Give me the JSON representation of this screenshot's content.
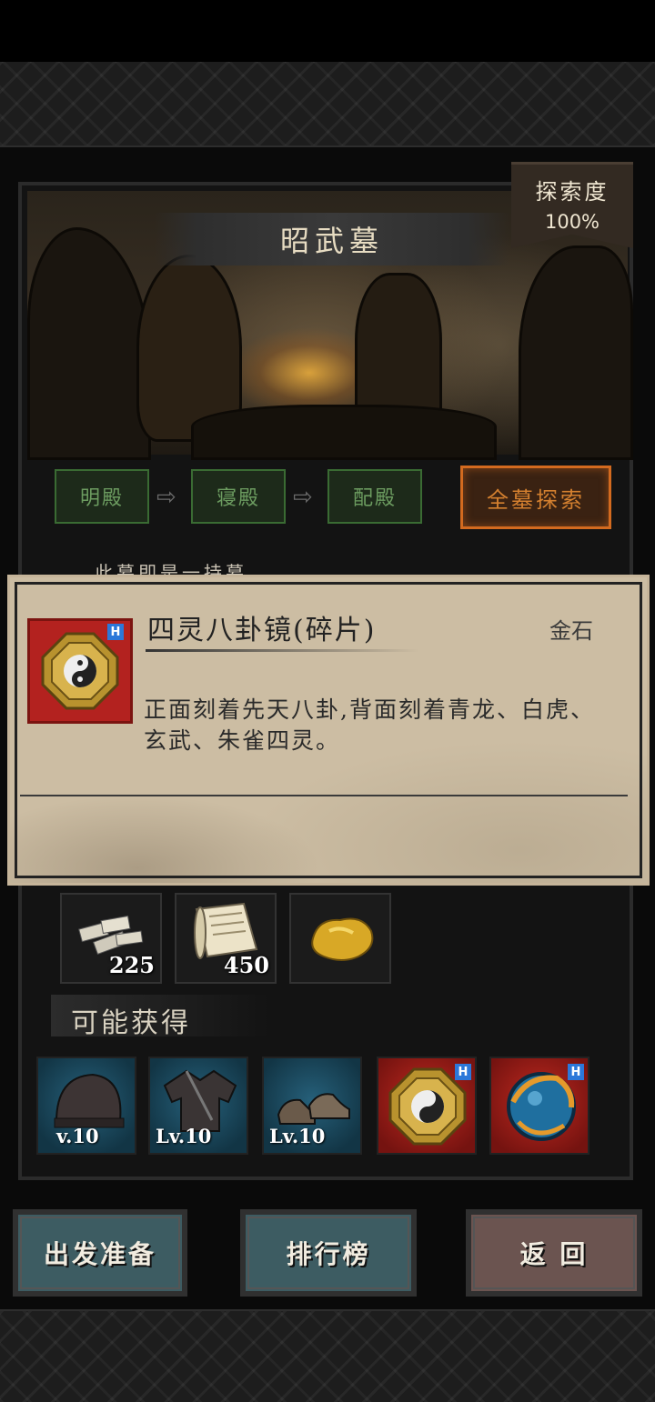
{
  "location": {
    "title": "昭武墓",
    "explore_label": "探索度",
    "explore_value": "100%"
  },
  "stages": [
    "明殿",
    "寝殿",
    "配殿"
  ],
  "full_explore_label": "全墓探索",
  "hidden_text": "此墓即是一持墓",
  "item_tooltip": {
    "name": "四灵八卦镜(碎片)",
    "type": "金石",
    "description": "正面刻着先天八卦,背面刻着青龙、白虎、玄武、朱雀四灵。"
  },
  "rewards": [
    {
      "icon": "silver-ingots-icon",
      "count": "225"
    },
    {
      "icon": "scroll-icon",
      "count": "450"
    },
    {
      "icon": "gold-nugget-icon",
      "count": ""
    }
  ],
  "possible_label": "可能获得",
  "possible_items": [
    {
      "icon": "helmet-icon",
      "level": "v.10",
      "rarity": "blue"
    },
    {
      "icon": "armor-icon",
      "level": "Lv.10",
      "rarity": "blue"
    },
    {
      "icon": "shoes-icon",
      "level": "Lv.10",
      "rarity": "blue"
    },
    {
      "icon": "bagua-mirror-icon",
      "level": "",
      "rarity": "red"
    },
    {
      "icon": "orb-icon",
      "level": "",
      "rarity": "red"
    }
  ],
  "buttons": {
    "prepare": "出发准备",
    "ranking": "排行榜",
    "back": "返 回"
  },
  "colors": {
    "accent_orange": "#d36a1f",
    "stage_green": "#3a6b33",
    "rarity_blue": "#26607a",
    "rarity_red": "#b3221f",
    "tag_blue": "#2c78d9"
  }
}
